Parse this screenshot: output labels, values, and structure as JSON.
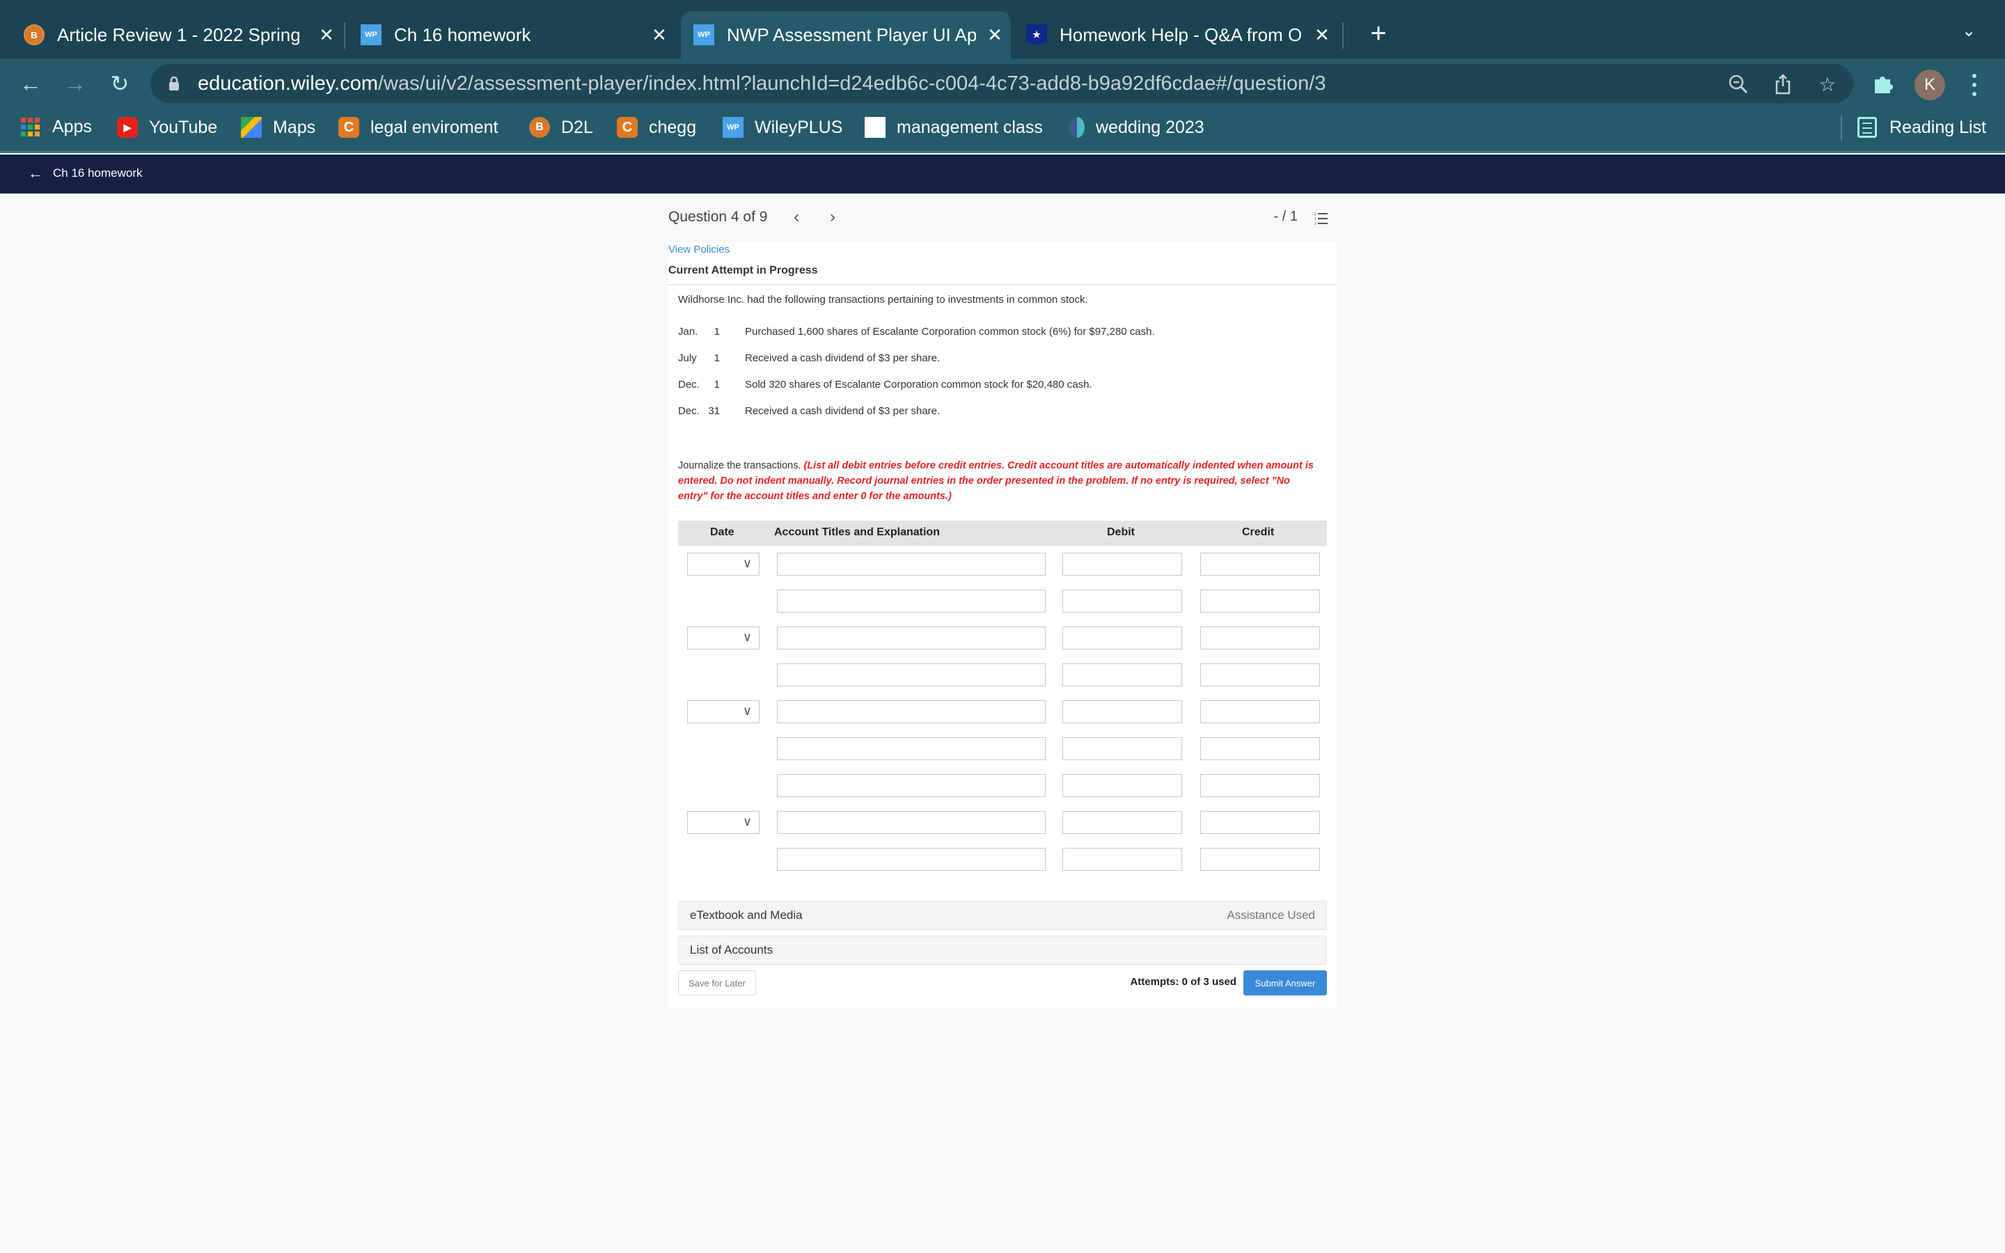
{
  "browser": {
    "tabs": [
      {
        "title": "Article Review 1 - 2022 Spring",
        "favicon": "d2l-icon",
        "active": false
      },
      {
        "title": "Ch 16 homework",
        "favicon": "wp-icon",
        "active": false
      },
      {
        "title": "NWP Assessment Player UI Ap",
        "favicon": "wp-icon",
        "active": true
      },
      {
        "title": "Homework Help - Q&A from Or",
        "favicon": "star-badge-icon",
        "active": false
      }
    ],
    "close_glyph": "✕",
    "new_tab_glyph": "+",
    "tabs_dropdown_glyph": "⌄",
    "url_host": "education.wiley.com",
    "url_path": "/was/ui/v2/assessment-player/index.html?launchId=d24edb6c-c004-4c73-add8-b9a92df6cdae#/question/3",
    "avatar_initial": "K",
    "bookmarks": [
      {
        "label": "Apps",
        "icon": "apps-grid-icon"
      },
      {
        "label": "YouTube",
        "icon": "youtube-icon"
      },
      {
        "label": "Maps",
        "icon": "maps-icon"
      },
      {
        "label": "legal enviroment",
        "icon": "chegg-c-icon"
      },
      {
        "label": "D2L",
        "icon": "d2l-icon"
      },
      {
        "label": "chegg",
        "icon": "chegg-c-icon"
      },
      {
        "label": "WileyPLUS",
        "icon": "wp-icon"
      },
      {
        "label": "management class",
        "icon": "management-icon"
      },
      {
        "label": "wedding 2023",
        "icon": "heart-icon"
      }
    ],
    "reading_list": "Reading List"
  },
  "appbar": {
    "back_label": "Ch 16 homework"
  },
  "question_nav": {
    "title": "Question 4 of 9",
    "prev_glyph": "‹",
    "next_glyph": "›",
    "score": "- / 1"
  },
  "question": {
    "view_policies": "View Policies",
    "attempt_status": "Current Attempt in Progress",
    "intro": "Wildhorse Inc. had the following transactions pertaining to investments in common stock.",
    "transactions": [
      {
        "month": "Jan.",
        "day": "1",
        "text": "Purchased 1,600 shares of Escalante Corporation common stock (6%) for $97,280 cash."
      },
      {
        "month": "July",
        "day": "1",
        "text": "Received a cash dividend of $3 per share."
      },
      {
        "month": "Dec.",
        "day": "1",
        "text": "Sold 320 shares of Escalante Corporation common stock for $20,480 cash."
      },
      {
        "month": "Dec.",
        "day": "31",
        "text": "Received a cash dividend of $3 per share."
      }
    ],
    "instruction_lead": "Journalize the transactions. ",
    "instruction_note": "(List all debit entries before credit entries. Credit account titles are automatically indented when amount is entered. Do not indent manually. Record journal entries in the order presented in the problem. If no entry is required, select \"No entry\" for the account titles and enter 0 for the amounts.)"
  },
  "journal": {
    "headers": {
      "date": "Date",
      "account": "Account Titles and Explanation",
      "debit": "Debit",
      "credit": "Credit"
    },
    "rows": [
      {
        "has_date": true,
        "date": "",
        "account": "",
        "debit": "",
        "credit": ""
      },
      {
        "has_date": false,
        "date": "",
        "account": "",
        "debit": "",
        "credit": ""
      },
      {
        "has_date": true,
        "date": "",
        "account": "",
        "debit": "",
        "credit": ""
      },
      {
        "has_date": false,
        "date": "",
        "account": "",
        "debit": "",
        "credit": ""
      },
      {
        "has_date": true,
        "date": "",
        "account": "",
        "debit": "",
        "credit": ""
      },
      {
        "has_date": false,
        "date": "",
        "account": "",
        "debit": "",
        "credit": ""
      },
      {
        "has_date": false,
        "date": "",
        "account": "",
        "debit": "",
        "credit": ""
      },
      {
        "has_date": true,
        "date": "",
        "account": "",
        "debit": "",
        "credit": ""
      },
      {
        "has_date": false,
        "date": "",
        "account": "",
        "debit": "",
        "credit": ""
      }
    ]
  },
  "resources": {
    "etextbook": "eTextbook and Media",
    "assistance": "Assistance Used",
    "list_of_accounts": "List of Accounts"
  },
  "footer": {
    "save_label": "Save for Later",
    "attempts": "Attempts: 0 of 3 used",
    "submit_label": "Submit Answer"
  },
  "colors": {
    "tabstrip": "#1b4351",
    "toolbar": "#245a69",
    "appbar": "#172044",
    "link": "#3a8ad6",
    "instruction_red": "#e22424",
    "submit": "#3b8ad9"
  }
}
